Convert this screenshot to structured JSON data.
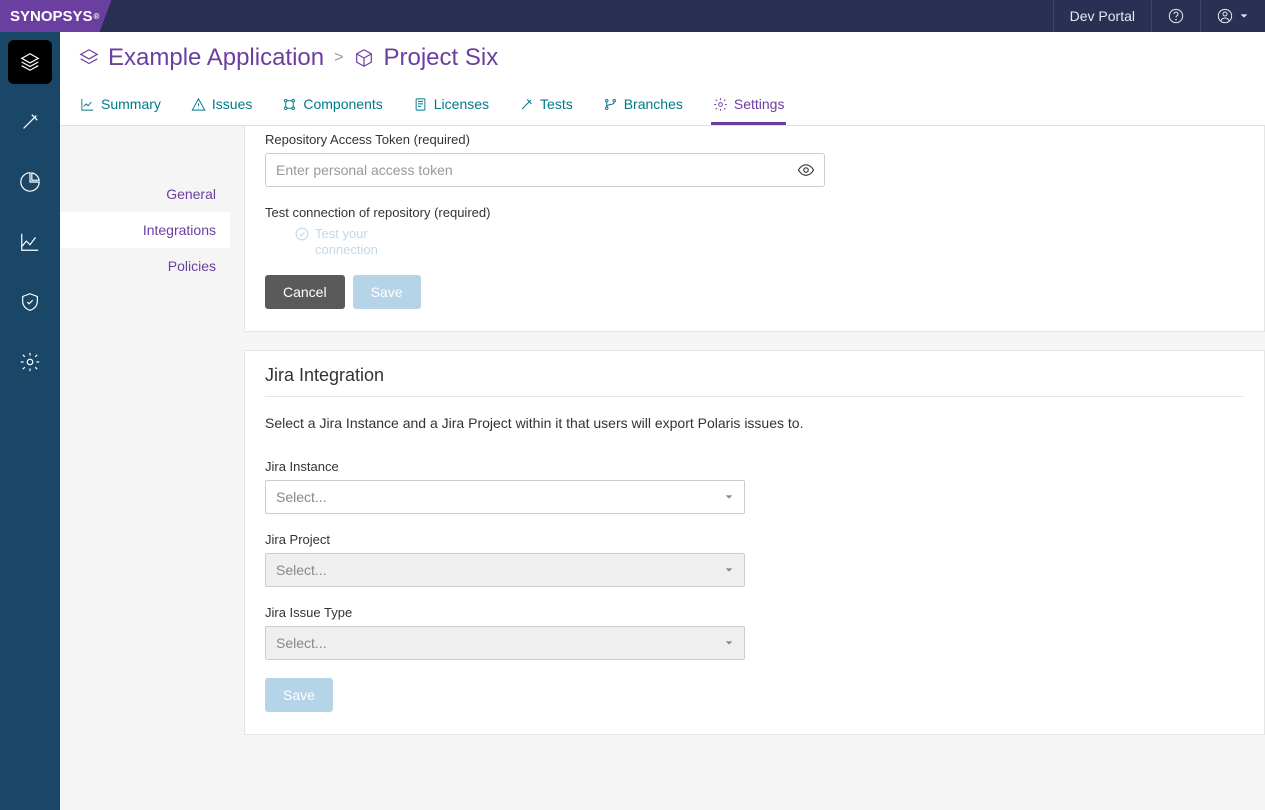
{
  "brand": "SYNOPSYS",
  "topbar": {
    "dev_portal": "Dev Portal"
  },
  "breadcrumb": {
    "app": "Example Application",
    "project": "Project Six"
  },
  "tabs": {
    "summary": "Summary",
    "issues": "Issues",
    "components": "Components",
    "licenses": "Licenses",
    "tests": "Tests",
    "branches": "Branches",
    "settings": "Settings"
  },
  "subnav": {
    "general": "General",
    "integrations": "Integrations",
    "policies": "Policies"
  },
  "repo": {
    "token_label": "Repository Access Token (required)",
    "token_placeholder": "Enter personal access token",
    "test_label": "Test connection of repository (required)",
    "test_link": "Test your connection",
    "cancel": "Cancel",
    "save": "Save"
  },
  "jira": {
    "heading": "Jira Integration",
    "description": "Select a Jira Instance and a Jira Project within it that users will export Polaris issues to.",
    "instance_label": "Jira Instance",
    "project_label": "Jira Project",
    "issuetype_label": "Jira Issue Type",
    "select_placeholder": "Select...",
    "save": "Save"
  }
}
